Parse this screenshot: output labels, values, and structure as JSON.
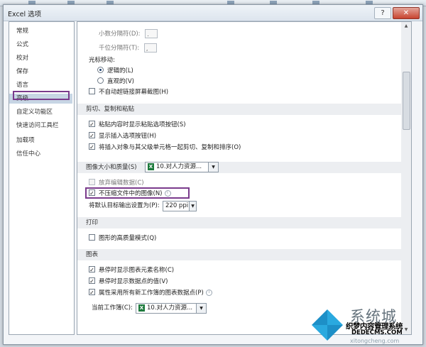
{
  "window": {
    "title": "Excel 选项",
    "help_label": "?",
    "close_label": "✕"
  },
  "nav": {
    "items": [
      "常规",
      "公式",
      "校对",
      "保存",
      "语言",
      "高级",
      "自定义功能区",
      "快速访问工具栏",
      "加载项",
      "信任中心"
    ],
    "active_index": 5
  },
  "advanced": {
    "decimal_sep_label": "小数分隔符(D):",
    "decimal_sep_value": ".",
    "thousands_sep_label": "千位分隔符(T):",
    "thousands_sep_value": ",",
    "cursor_label": "光标移动:",
    "cursor_logical": "逻辑的(L)",
    "cursor_visual": "直观的(V)",
    "no_autohyperlink": "不自动超链接屏幕截图(H)"
  },
  "cut_copy": {
    "header": "剪切、复制和粘贴",
    "show_paste_options": "粘贴内容时显示粘贴选项按钮(S)",
    "show_insert_options": "显示插入选项按钮(H)",
    "cut_copy_sort": "将插入对象与其父级单元格一起剪切、复制和排序(O)"
  },
  "image": {
    "header": "图像大小和质量(S)",
    "workbook": "10.对人力资源...",
    "discard_edit_data": "放弃编辑数据(C)",
    "no_compress": "不压缩文件中的图像(N)",
    "default_output_label": "将默认目标输出设置为(P):",
    "default_output_value": "220 ppi"
  },
  "print": {
    "header": "打印",
    "high_quality": "图形的高质量模式(Q)"
  },
  "charts": {
    "header": "图表",
    "show_element_names": "悬停时显示图表元素名称(C)",
    "show_point_values": "悬停时显示数据点的值(V)",
    "properties_follow": "属性采用所有新工作簿的图表数据点(P)",
    "current_workbook_label": "当前工作簿(C):",
    "current_workbook_value": "10.对人力资源..."
  },
  "icons": {
    "excel": "X",
    "info": "i",
    "check": "✓",
    "dropdown": "▼",
    "up": "▲"
  },
  "watermark": {
    "brand": "系统城",
    "line1": "织梦内容管理系统",
    "line2": "DEDECMS.COM",
    "url": "xitongcheng.com"
  },
  "colors": {
    "highlight": "#7a3b8c",
    "active_nav": "#c7d5e4"
  }
}
